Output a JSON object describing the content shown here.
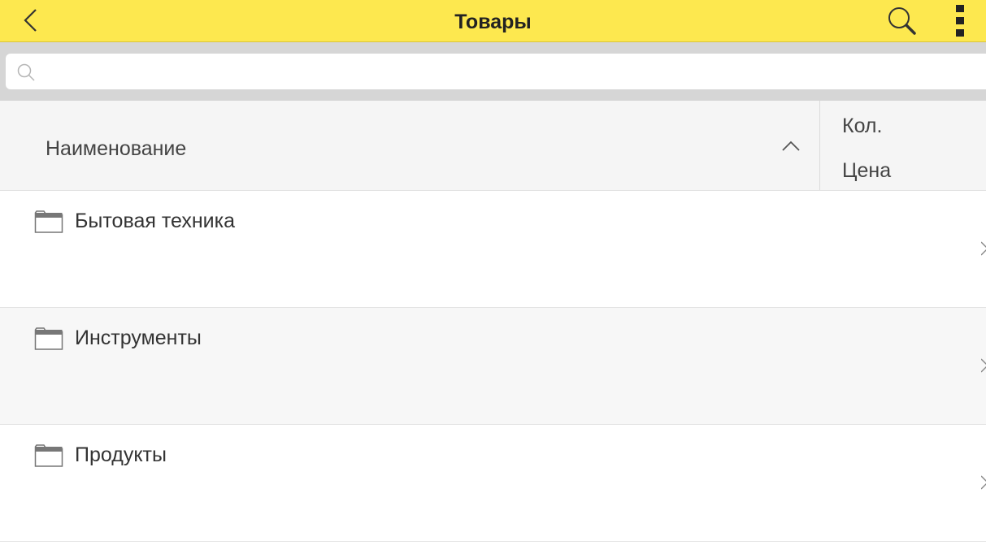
{
  "app_bar": {
    "title": "Товары",
    "back_icon": "chevron-left-icon",
    "search_icon": "search-icon",
    "menu_icon": "more-vertical-icon",
    "background_color": "#fde84f"
  },
  "search": {
    "placeholder": "",
    "value": "",
    "icon": "search-icon"
  },
  "table_header": {
    "name_column": "Наименование",
    "sort_icon": "chevron-up-icon",
    "qty_column": "Кол.",
    "price_column": "Цена"
  },
  "rows": [
    {
      "icon": "folder-icon",
      "label": "Бытовая техника"
    },
    {
      "icon": "folder-icon",
      "label": "Инструменты"
    },
    {
      "icon": "folder-icon",
      "label": "Продукты"
    }
  ]
}
